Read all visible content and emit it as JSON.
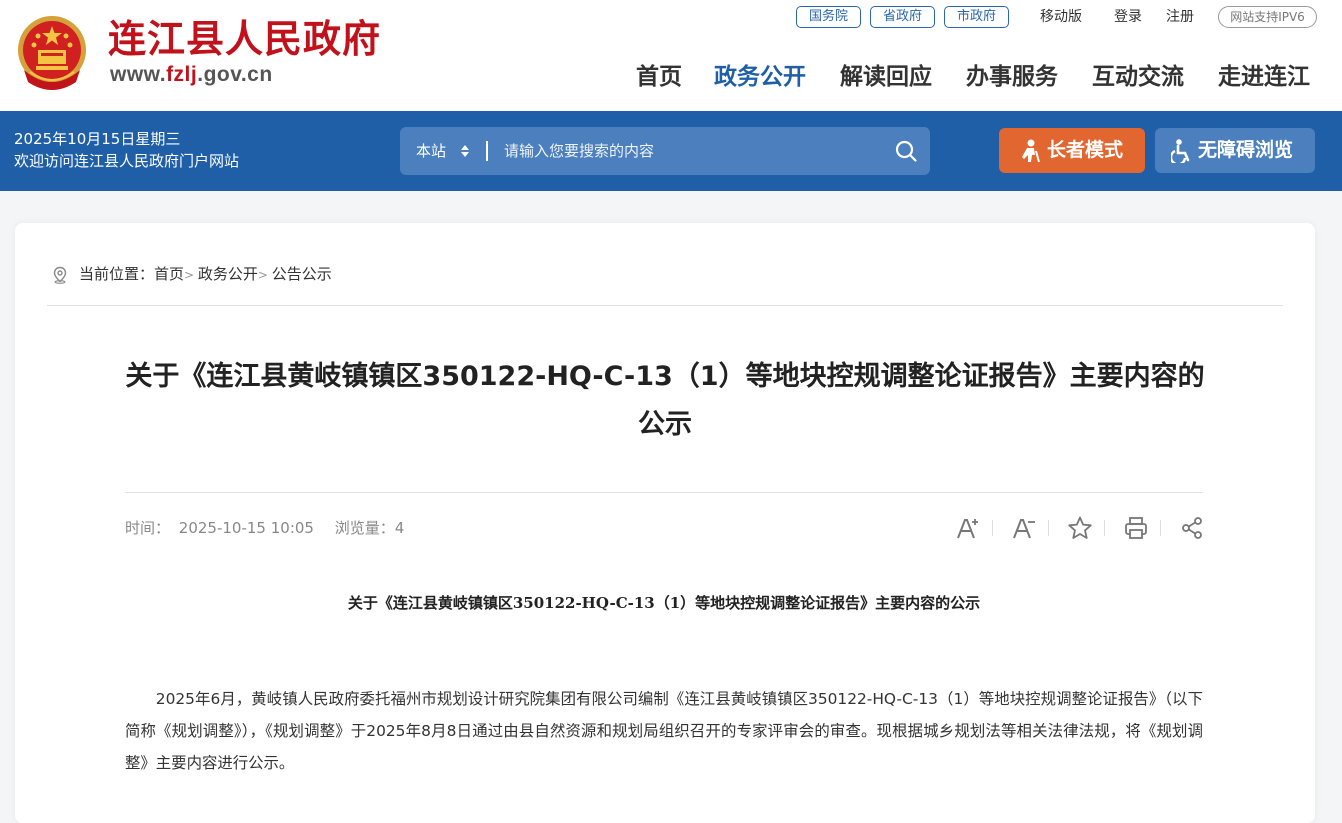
{
  "header": {
    "site_name": "连江县人民政府",
    "site_url_prefix": "www.",
    "site_url_highlight": "fzlj",
    "site_url_suffix": ".gov.cn",
    "top_links": {
      "state_council": "国务院",
      "province": "省政府",
      "city": "市政府",
      "mobile": "移动版",
      "login": "登录",
      "register": "注册",
      "ipv6": "网站支持IPV6"
    },
    "nav": [
      "首页",
      "政务公开",
      "解读回应",
      "办事服务",
      "互动交流",
      "走进连江"
    ],
    "nav_active_index": 1
  },
  "bar": {
    "date": "2025年10月15日星期三",
    "welcome": "欢迎访问连江县人民政府门户网站",
    "search_scope": "本站",
    "search_placeholder": "请输入您要搜索的内容",
    "elder_mode": "长者模式",
    "accessibility": "无障碍浏览"
  },
  "breadcrumb": {
    "label": "当前位置：",
    "items": [
      "首页",
      "政务公开",
      "公告公示"
    ]
  },
  "article": {
    "title": "关于《连江县黄岐镇镇区350122-HQ-C-13（1）等地块控规调整论证报告》主要内容的公示",
    "time_label": "时间：",
    "time_value": "2025-10-15 10:05",
    "views_label": "浏览量：",
    "views_value": "4",
    "doc_title": "关于《连江县黄岐镇镇区350122-HQ-C-13（1）等地块控规调整论证报告》主要内容的公示",
    "paragraph": "2025年6月，黄岐镇人民政府委托福州市规划设计研究院集团有限公司编制《连江县黄岐镇镇区350122-HQ-C-13（1）等地块控规调整论证报告》（以下简称《规划调整》），《规划调整》于2025年8月8日通过由县自然资源和规划局组织召开的专家评审会的审查。现根据城乡规划法等相关法律法规，将《规划调整》主要内容进行公示。"
  },
  "icons": [
    "national-emblem-icon",
    "chevron-updown-icon",
    "search-icon",
    "elder-icon",
    "wheelchair-icon",
    "location-pin-icon",
    "font-increase-icon",
    "font-decrease-icon",
    "star-icon",
    "print-icon",
    "share-icon"
  ],
  "colors": {
    "brand_red": "#c1121c",
    "primary_blue": "#1f5fa8",
    "elder_orange": "#e2662f"
  }
}
